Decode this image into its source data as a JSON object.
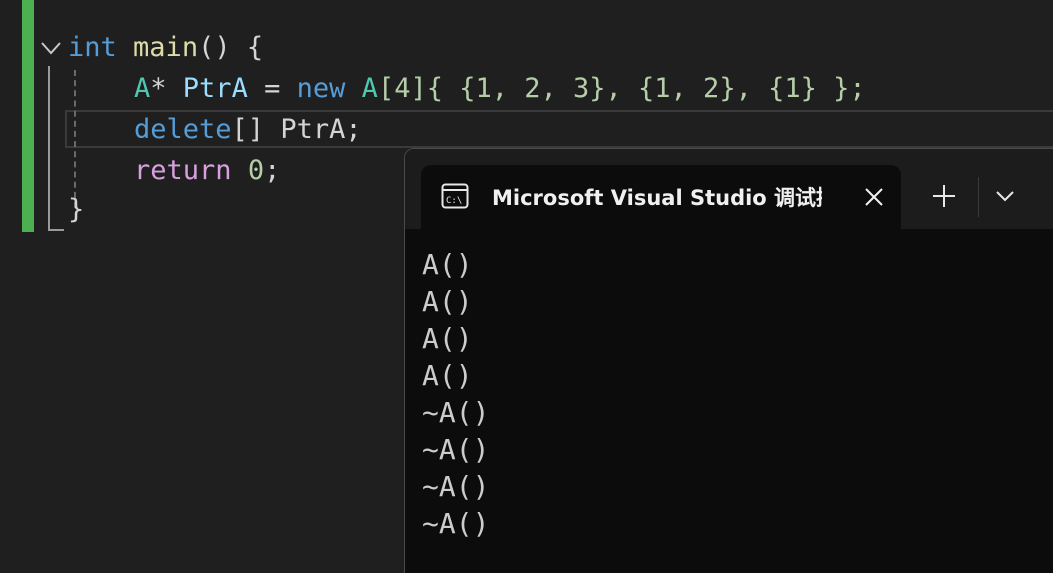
{
  "editor": {
    "lines": [
      {
        "kw": "int",
        "fn": "main",
        "rest": "() {"
      },
      {
        "type1": "A",
        "star": "*",
        "var": "PtrA",
        "eq": "=",
        "kw": "new",
        "type2": "A",
        "bracket": "[4]",
        "init": "{ {1, 2, 3}, {1, 2}, {1} };"
      },
      {
        "kw": "delete",
        "brackets": "[]",
        "var": "PtrA",
        "semi": ";"
      },
      {
        "kw": "return",
        "num": "0",
        "semi": ";"
      },
      {
        "brace": "}"
      }
    ],
    "accent_colors": {
      "change_bar": "#4caf50",
      "keyword": "#569cd6",
      "control_keyword": "#d8a0df",
      "function": "#dcdcaa",
      "type": "#4ec9b0",
      "variable": "#9cdcfe",
      "number": "#b5cea8"
    }
  },
  "terminal": {
    "tab": {
      "icon": "console-icon",
      "title": "Microsoft Visual Studio 调试控制台",
      "close_icon": "close-icon"
    },
    "new_tab_icon": "plus-icon",
    "dropdown_icon": "chevron-down-icon",
    "output": [
      "A()",
      "A()",
      "A()",
      "A()",
      "~A()",
      "~A()",
      "~A()",
      "~A()"
    ]
  }
}
